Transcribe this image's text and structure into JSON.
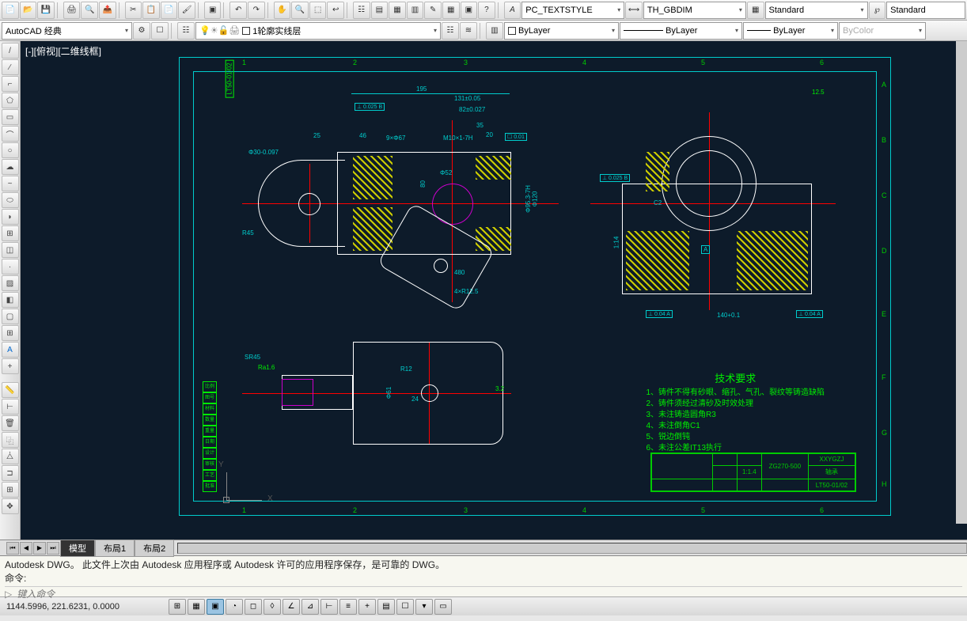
{
  "toolbar1": {
    "textstyle_label": "PC_TEXTSTYLE",
    "dimstyle_label": "TH_GBDIM",
    "tablestyle_label": "Standard",
    "mlstyle_label": "Standard"
  },
  "toolbar2": {
    "workspace": "AutoCAD 经典",
    "layer_name": "1轮廓实线层",
    "linetype_bylayer": "ByLayer",
    "lineweight_bylayer": "ByLayer",
    "color_bycolor": "ByColor"
  },
  "view": {
    "label": "[-][俯视][二维线框]"
  },
  "drawing": {
    "frame_ref": "LT50-01/02",
    "grid_cols": [
      "1",
      "2",
      "3",
      "4",
      "5",
      "6"
    ],
    "grid_rows": [
      "A",
      "B",
      "C",
      "D",
      "E",
      "F",
      "G",
      "H"
    ],
    "dims": {
      "d195": "195",
      "d131": "131±0.05",
      "d82": "82±0.027",
      "tol0025": "⊥ 0.025 B",
      "d25": "25",
      "d46": "46",
      "thread": "M10×1-7H",
      "d80": "80",
      "d20": "20",
      "d35": "35",
      "r45": "R45",
      "r125": "4×R12.5",
      "d480": "480",
      "phi52": "Φ52",
      "phi120": "Φ120",
      "phi95": "Φ95.3-7H",
      "d3007097": "Φ30-0.097",
      "r12": "R12",
      "d140": "140+0.1",
      "d24": "24",
      "sr45": "SR45",
      "ra16": "Ra1.6",
      "ra32": "3.2",
      "ra125": "12.5",
      "tol004a": "⊥ 0.04 A",
      "tol0025b2": "⊥ 0.025 B",
      "c2": "C2",
      "deg61": "Φ61",
      "d52b": "1:14",
      "d9x67": "9×Φ67",
      "d001": "☐ 0.01"
    },
    "datum_a": "A",
    "datum_b": "B"
  },
  "tech": {
    "title": "技术要求",
    "items": [
      "1、铸件不得有砂眼、缩孔、气孔、裂纹等铸造缺陷",
      "2、铸件须经过清砂及时效处理",
      "3、未注铸造圆角R3",
      "4、未注倒角C1",
      "5、锐边倒钝",
      "6、未注公差IT13执行"
    ]
  },
  "titleblock": {
    "material": "ZG270-500",
    "company": "XXYGZJ",
    "partname": "轴承",
    "drawing_no": "LT50-01/02",
    "scale": "1:1.4"
  },
  "tabs": {
    "model": "模型",
    "layout1": "布局1",
    "layout2": "布局2"
  },
  "cmd": {
    "line1": "Autodesk DWG。  此文件上次由 Autodesk 应用程序或 Autodesk 许可的应用程序保存，是可靠的 DWG。",
    "line2": "命令:",
    "prompt_icon": "▷",
    "placeholder": "键入命令"
  },
  "status": {
    "coords": "1144.5996, 221.6231, 0.0000"
  },
  "axes": {
    "y": "Y",
    "x": "X"
  }
}
